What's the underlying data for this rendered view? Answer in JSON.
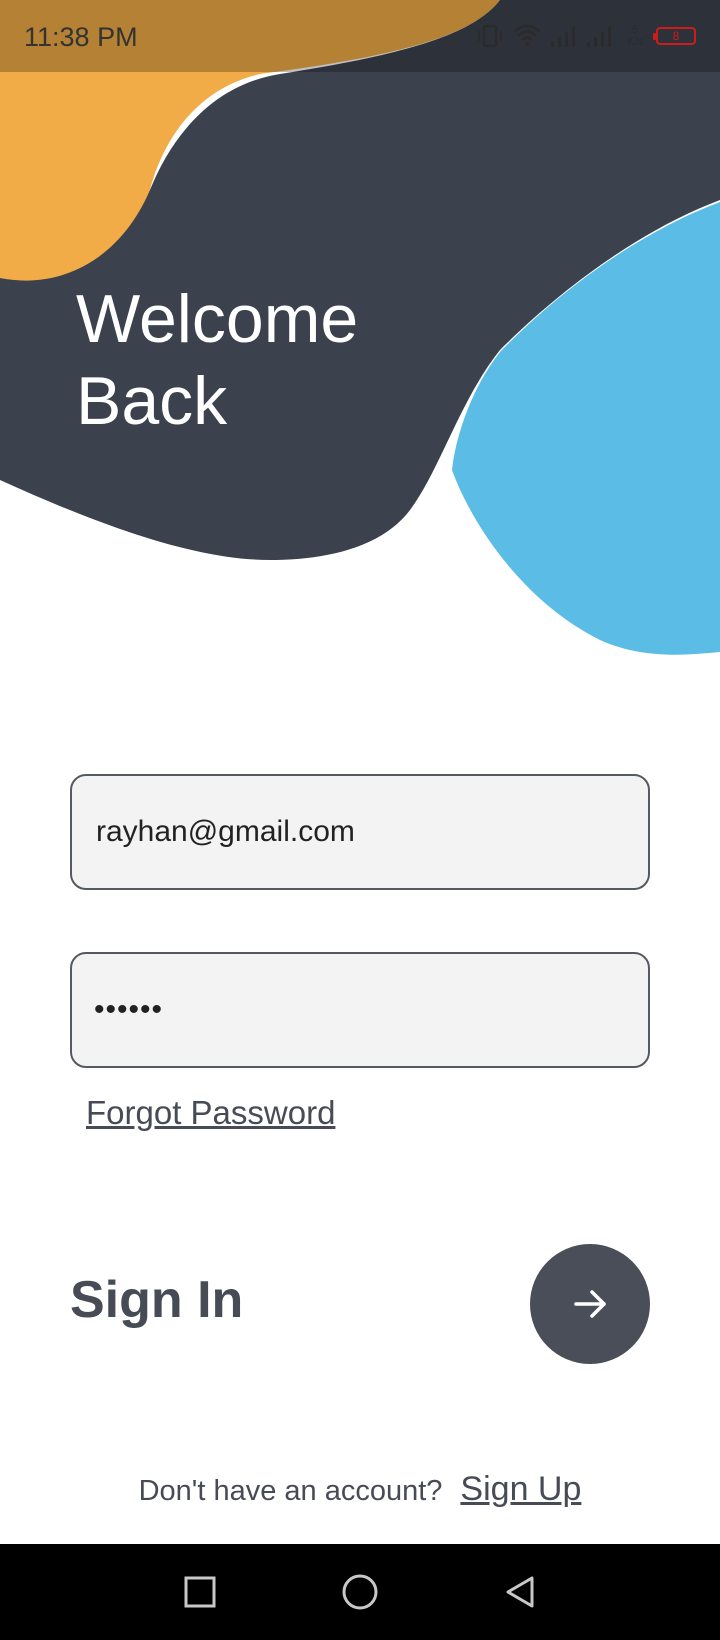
{
  "status_bar": {
    "time": "11:38 PM",
    "net_speed_value": "5",
    "net_speed_unit": "K/s",
    "battery_level": "8",
    "icons": [
      "vibrate-icon",
      "wifi-icon",
      "signal-icon",
      "signal-icon-2"
    ]
  },
  "header": {
    "welcome_line1": "Welcome",
    "welcome_line2": "Back"
  },
  "form": {
    "email_value": "rayhan@gmail.com",
    "password_value": "••••••",
    "forgot_label": "Forgot Password"
  },
  "signin": {
    "title": "Sign In",
    "button_icon": "arrow-right-icon"
  },
  "footer": {
    "prompt": "Don't have an account?",
    "signup_label": "Sign Up"
  },
  "nav_bar": {
    "icons": [
      "recent-apps-icon",
      "home-icon",
      "back-icon"
    ]
  },
  "colors": {
    "dark_blob": "#3c424d",
    "orange_blob": "#f2ac47",
    "blue_blob": "#5bbde5",
    "text_dark": "#474b55",
    "button_bg": "#4a4e59"
  }
}
